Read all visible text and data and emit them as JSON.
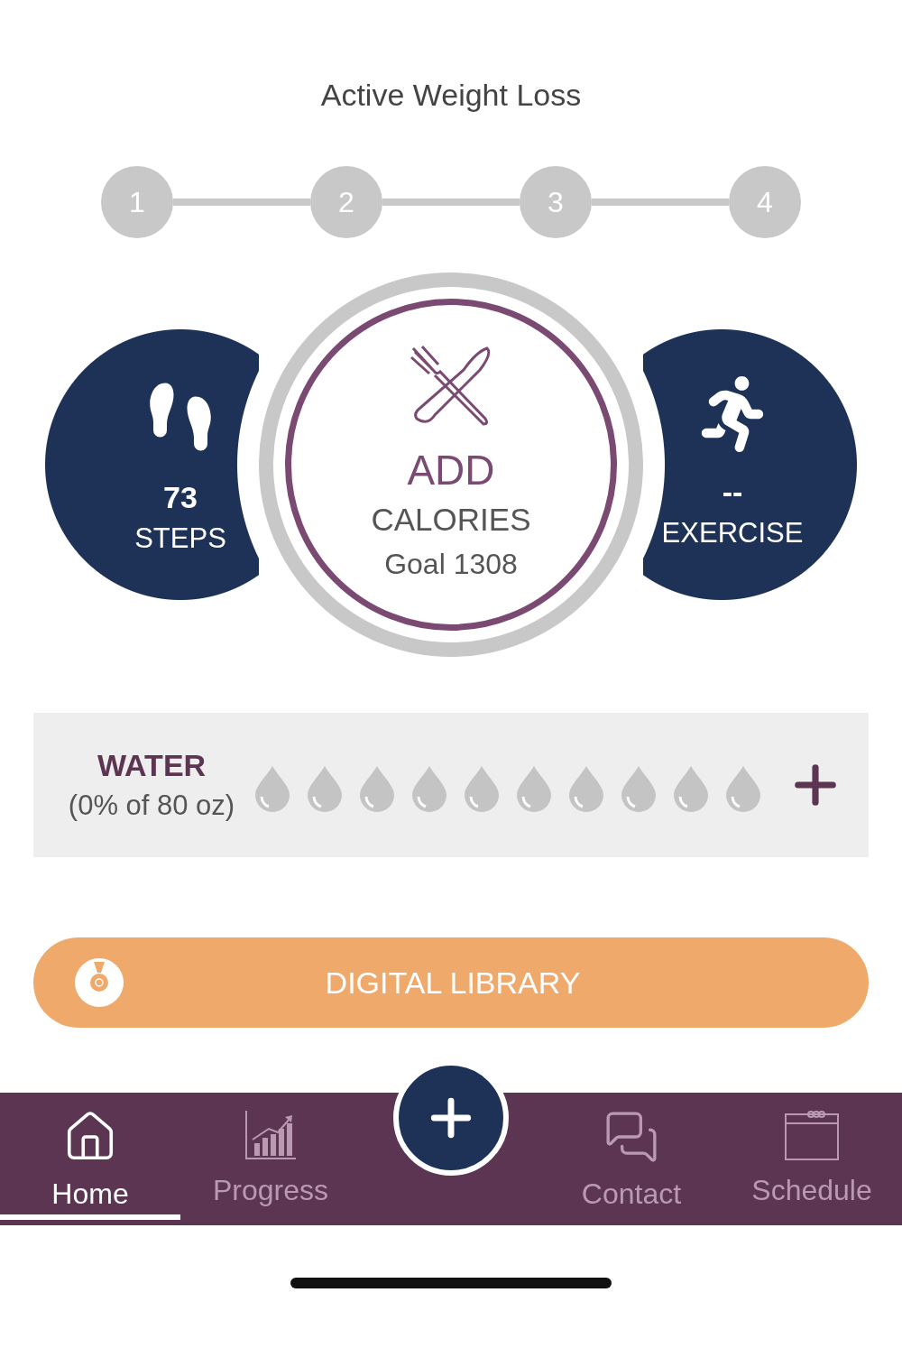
{
  "header": {
    "title": "Active Weight Loss"
  },
  "stepper": {
    "steps": [
      {
        "label": "1"
      },
      {
        "label": "2"
      },
      {
        "label": "3"
      },
      {
        "label": "4"
      }
    ]
  },
  "stats": {
    "steps": {
      "value": "73",
      "label": "STEPS"
    },
    "calories": {
      "action": "ADD",
      "label": "CALORIES",
      "goal": "Goal 1308"
    },
    "exercise": {
      "value": "--",
      "label": "EXERCISE"
    }
  },
  "water": {
    "title": "WATER",
    "summary": "(0% of 80 oz)",
    "drops": [
      {
        "filled": false
      },
      {
        "filled": false
      },
      {
        "filled": false
      },
      {
        "filled": false
      },
      {
        "filled": false
      },
      {
        "filled": false
      },
      {
        "filled": false
      },
      {
        "filled": false
      },
      {
        "filled": false
      },
      {
        "filled": false
      }
    ]
  },
  "library_button": {
    "label": "DIGITAL LIBRARY"
  },
  "tab_bar": {
    "tabs": [
      {
        "kind": "home",
        "label": "Home",
        "selected": true
      },
      {
        "kind": "progress",
        "label": "Progress",
        "selected": false
      },
      {
        "kind": "contact",
        "label": "Contact",
        "selected": false
      },
      {
        "kind": "schedule",
        "label": "Schedule",
        "selected": false
      }
    ]
  }
}
